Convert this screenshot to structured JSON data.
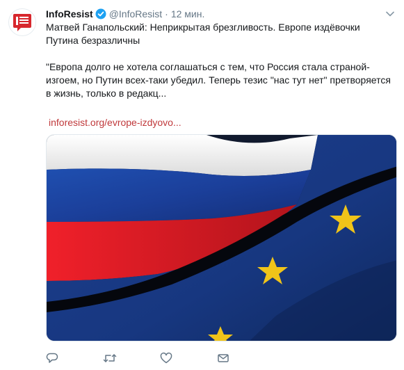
{
  "tweet": {
    "author_name": "InfoResist",
    "handle": "@InfoResist",
    "separator": "·",
    "time": "12 мин.",
    "headline": "Матвей Ганапольский: Неприкрытая брезгливость. Европе издёвочки Путина безразличны",
    "quote": "\"Европа долго не хотела соглашаться с тем, что Россия стала страной-изгоем, но Путин всех-таки убедил. Теперь тезис \"нас тут нет\" претворяется в жизнь, только в редакц...",
    "link": "inforesist.org/evrope-izdyovo..."
  },
  "icons": {
    "avatar": "inforesist-logo-icon",
    "verified": "verified-badge-icon",
    "caret": "chevron-down-icon",
    "reply": "reply-icon",
    "retweet": "retweet-icon",
    "like": "heart-icon",
    "dm": "envelope-icon"
  },
  "colors": {
    "link": "#c0393b",
    "verified": "#1da1f2",
    "brand": "#d7272d",
    "icon_gray": "#657786"
  }
}
